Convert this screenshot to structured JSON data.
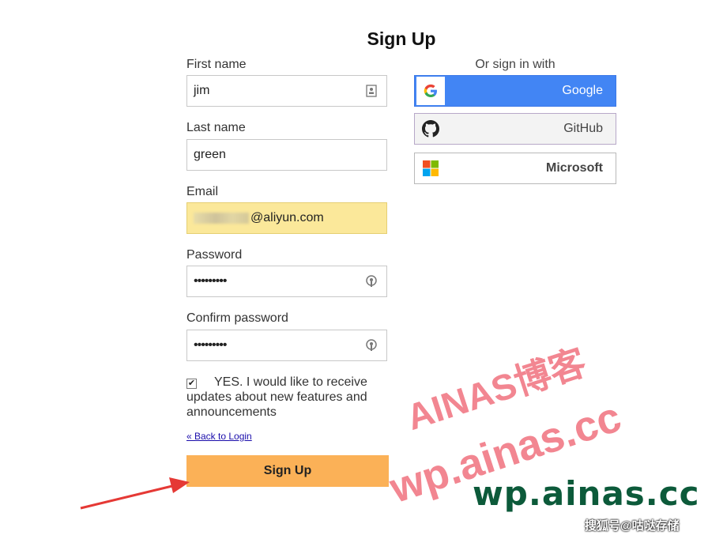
{
  "title": "Sign Up",
  "form": {
    "first_name": {
      "label": "First name",
      "value": "jim"
    },
    "last_name": {
      "label": "Last name",
      "value": "green"
    },
    "email": {
      "label": "Email",
      "value_visible": "@aliyun.com"
    },
    "password": {
      "label": "Password",
      "value": "•••••••••"
    },
    "confirm_password": {
      "label": "Confirm password",
      "value": "•••••••••"
    },
    "updates_checkbox": {
      "checked": true,
      "label": "YES. I would like to receive updates about new features and announcements"
    },
    "back_link": "« Back to Login",
    "submit_label": "Sign Up"
  },
  "social": {
    "heading": "Or sign in with",
    "providers": [
      {
        "label": "Google",
        "icon": "google-icon",
        "color": "#4285f4"
      },
      {
        "label": "GitHub",
        "icon": "github-icon",
        "color": "#f3f3f3"
      },
      {
        "label": "Microsoft",
        "icon": "microsoft-icon",
        "color": "#ffffff"
      }
    ]
  },
  "watermarks": {
    "line1": "AINAS博客",
    "line2": "wp.ainas.cc",
    "line3": "wp.ainas.cc",
    "credit": "搜狐号@咕哒存储"
  },
  "colors": {
    "accent_button": "#fbb157",
    "email_autofill": "#fbe89a",
    "watermark_pink": "#f06c79",
    "watermark_green": "#0c5a3a",
    "arrow": "#e53935"
  }
}
